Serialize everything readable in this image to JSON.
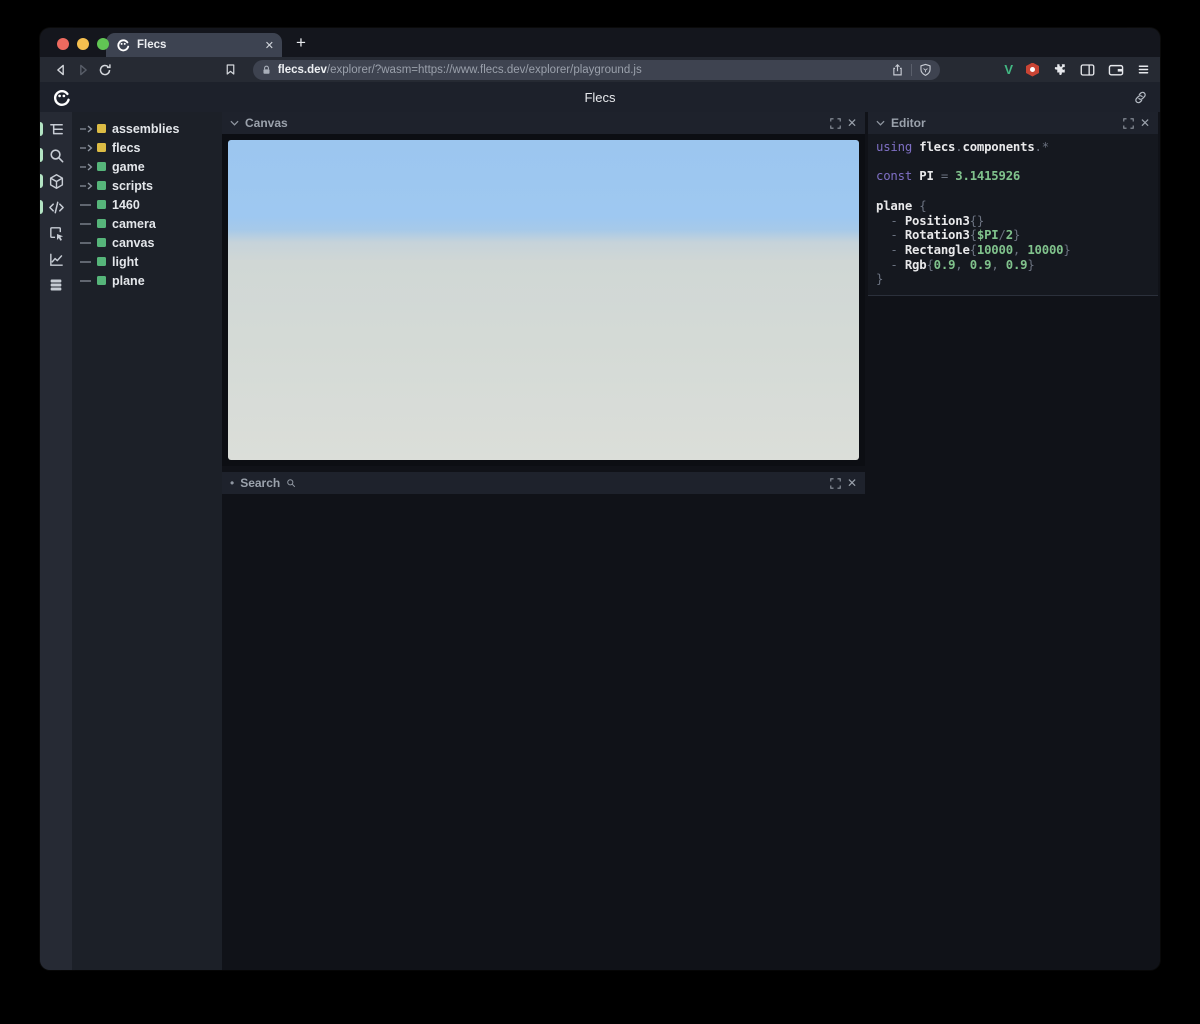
{
  "browser": {
    "tab": {
      "title": "Flecs",
      "close_label": "✕"
    },
    "new_tab_label": "+",
    "url": {
      "domain": "flecs.dev",
      "path": "/explorer/?wasm=https://www.flecs.dev/explorer/playground.js"
    },
    "extensions": {
      "vue_label": "V"
    }
  },
  "app": {
    "header_title": "Flecs"
  },
  "sidebar": {
    "icons": [
      {
        "name": "tree-icon",
        "active": true
      },
      {
        "name": "search-icon",
        "active": true
      },
      {
        "name": "cube-icon",
        "active": true
      },
      {
        "name": "code-icon",
        "active": true
      },
      {
        "name": "inspector-icon",
        "active": false
      },
      {
        "name": "chart-icon",
        "active": false
      },
      {
        "name": "rows-icon",
        "active": false
      }
    ]
  },
  "tree": {
    "items": [
      {
        "label": "assemblies",
        "square": "yellow",
        "expandable": true
      },
      {
        "label": "flecs",
        "square": "yellow",
        "expandable": true
      },
      {
        "label": "game",
        "square": "green",
        "expandable": true
      },
      {
        "label": "scripts",
        "square": "green",
        "expandable": true
      },
      {
        "label": "1460",
        "square": "green",
        "expandable": false
      },
      {
        "label": "camera",
        "square": "green",
        "expandable": false
      },
      {
        "label": "canvas",
        "square": "green",
        "expandable": false
      },
      {
        "label": "light",
        "square": "green",
        "expandable": false
      },
      {
        "label": "plane",
        "square": "green",
        "expandable": false
      }
    ]
  },
  "panels": {
    "canvas": {
      "title": "Canvas",
      "close_label": "✕",
      "scene": "3D viewport: blue sky over light gray ground plane"
    },
    "search": {
      "title": "Search",
      "close_label": "✕"
    },
    "editor": {
      "title": "Editor",
      "close_label": "✕",
      "code": [
        [
          [
            "kw",
            "using "
          ],
          [
            "id",
            "flecs"
          ],
          [
            "pun",
            "."
          ],
          [
            "id",
            "components"
          ],
          [
            "pun",
            ".*"
          ]
        ],
        [],
        [
          [
            "kw",
            "const "
          ],
          [
            "id",
            "PI"
          ],
          [
            "pun",
            " = "
          ],
          [
            "num",
            "3.1415926"
          ]
        ],
        [],
        [
          [
            "id",
            "plane"
          ],
          [
            "pun",
            " {"
          ]
        ],
        [
          [
            "pun",
            "  - "
          ],
          [
            "id",
            "Position3"
          ],
          [
            "pun",
            "{}"
          ]
        ],
        [
          [
            "pun",
            "  - "
          ],
          [
            "id",
            "Rotation3"
          ],
          [
            "pun",
            "{"
          ],
          [
            "num",
            "$PI"
          ],
          [
            "pun",
            "/"
          ],
          [
            "num",
            "2"
          ],
          [
            "pun",
            "}"
          ]
        ],
        [
          [
            "pun",
            "  - "
          ],
          [
            "id",
            "Rectangle"
          ],
          [
            "pun",
            "{"
          ],
          [
            "num",
            "10000"
          ],
          [
            "pun",
            ", "
          ],
          [
            "num",
            "10000"
          ],
          [
            "pun",
            "}"
          ]
        ],
        [
          [
            "pun",
            "  - "
          ],
          [
            "id",
            "Rgb"
          ],
          [
            "pun",
            "{"
          ],
          [
            "num",
            "0.9"
          ],
          [
            "pun",
            ", "
          ],
          [
            "num",
            "0.9"
          ],
          [
            "pun",
            ", "
          ],
          [
            "num",
            "0.9"
          ],
          [
            "pun",
            "}"
          ]
        ],
        [
          [
            "pun",
            "}"
          ]
        ]
      ]
    }
  },
  "colors": {
    "kw": "#7e6fc4",
    "id": "#e8e8ea",
    "num": "#80c28c",
    "pun": "#6b7280",
    "yellow": "#dcbc45",
    "green": "#56b57a",
    "indicator": "#b3e4c3",
    "vue_green": "#42b883",
    "ext_red": "#c94434",
    "sky": "#9cc6ef",
    "ground": "#d7dcd7"
  }
}
